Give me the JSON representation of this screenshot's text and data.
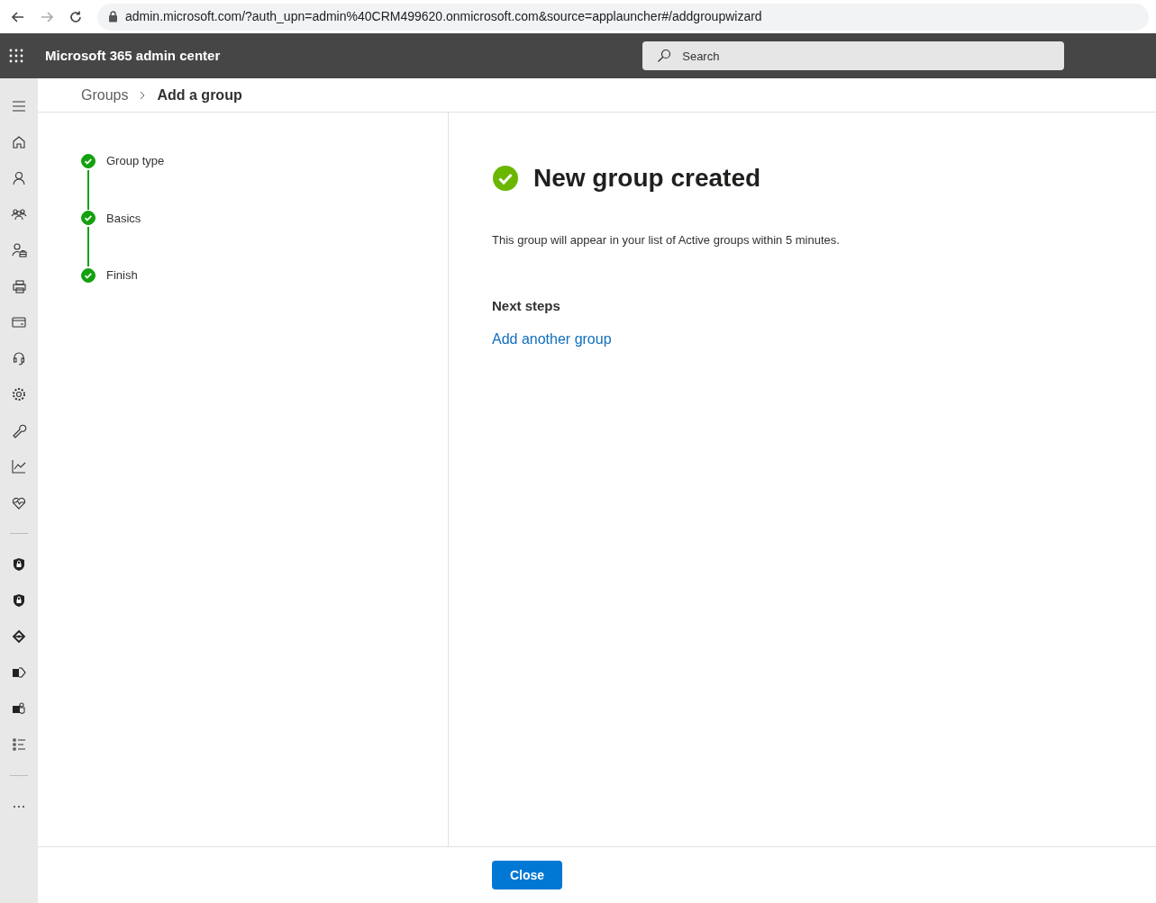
{
  "browser": {
    "url": "admin.microsoft.com/?auth_upn=admin%40CRM499620.onmicrosoft.com&source=applauncher#/addgroupwizard"
  },
  "header": {
    "title": "Microsoft 365 admin center",
    "search": {
      "placeholder": "Search"
    }
  },
  "breadcrumb": [
    {
      "label": "Groups",
      "current": false
    },
    {
      "label": "Add a group",
      "current": true
    }
  ],
  "steps": [
    {
      "label": "Group type",
      "completed": true
    },
    {
      "label": "Basics",
      "completed": true
    },
    {
      "label": "Finish",
      "completed": true
    }
  ],
  "content": {
    "heading": "New group created",
    "message": "This group will appear in your list of Active groups within 5 minutes.",
    "next_steps": {
      "heading": "Next steps",
      "links": [
        "Add another group"
      ]
    }
  },
  "footer": {
    "buttons": [
      "Close"
    ]
  }
}
